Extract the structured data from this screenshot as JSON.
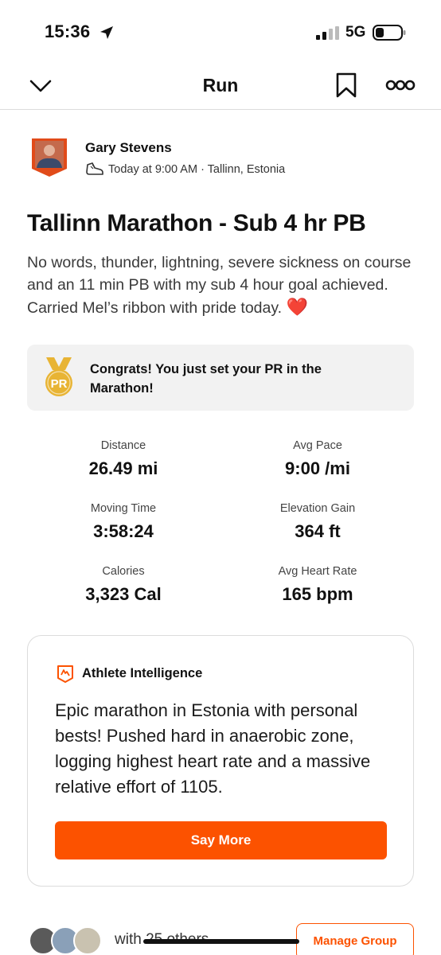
{
  "status_bar": {
    "time": "15:36",
    "network": "5G",
    "icons": [
      "location-arrow-icon",
      "signal-icon",
      "battery-icon"
    ]
  },
  "nav": {
    "title": "Run",
    "icons": [
      "chevron-down-icon",
      "bookmark-icon",
      "more-icon"
    ]
  },
  "athlete": {
    "name": "Gary Stevens",
    "meta": "Today at 9:00 AM · Tallinn, Estonia"
  },
  "activity": {
    "title": "Tallinn Marathon - Sub 4 hr PB",
    "description": "No words, thunder, lightning, severe sickness on course and an 11 min PB with my sub 4 hour goal achieved. Carried Mel’s ribbon with pride today.",
    "emoji": "❤️"
  },
  "pr_banner": {
    "badge": "PR",
    "text": "Congrats! You just set your PR in the Marathon!"
  },
  "stats": [
    {
      "label": "Distance",
      "value": "26.49 mi"
    },
    {
      "label": "Avg Pace",
      "value": "9:00 /mi"
    },
    {
      "label": "Moving Time",
      "value": "3:58:24"
    },
    {
      "label": "Elevation Gain",
      "value": "364 ft"
    },
    {
      "label": "Calories",
      "value": "3,323 Cal"
    },
    {
      "label": "Avg Heart Rate",
      "value": "165 bpm"
    }
  ],
  "athlete_intelligence": {
    "title": "Athlete Intelligence",
    "summary": "Epic marathon in Estonia with personal bests! Pushed hard in anaerobic zone, logging highest heart rate and a massive relative effort of 1105.",
    "button_label": "Say More"
  },
  "group": {
    "text": "with 25 others",
    "manage_label": "Manage Group"
  },
  "colors": {
    "accent": "#fc5200",
    "pr_box_bg": "#f2f2f2",
    "medal_gold": "#e8b434",
    "heart": "#e0202f"
  }
}
